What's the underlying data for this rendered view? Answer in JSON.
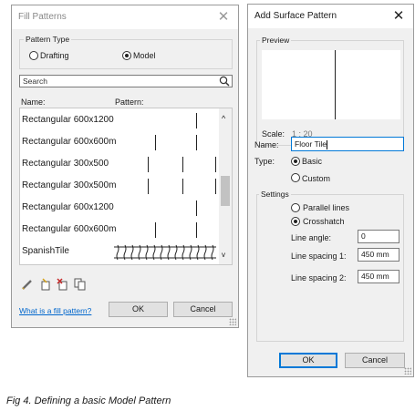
{
  "fill_patterns": {
    "title": "Fill Patterns",
    "pattern_type_label": "Pattern Type",
    "drafting_label": "Drafting",
    "model_label": "Model",
    "search_placeholder": "Search",
    "name_header": "Name:",
    "pattern_header": "Pattern:",
    "rows": [
      {
        "name": "Rectangular  600x1200"
      },
      {
        "name": "Rectangular  600x600m"
      },
      {
        "name": "Rectangular 300x500"
      },
      {
        "name": "Rectangular 300x500m"
      },
      {
        "name": "Rectangular 600x1200"
      },
      {
        "name": "Rectangular 600x600m"
      },
      {
        "name": "SpanishTile"
      }
    ],
    "help_link": "What is a fill pattern?",
    "ok_label": "OK",
    "cancel_label": "Cancel"
  },
  "add_surface_pattern": {
    "title": "Add Surface Pattern",
    "preview_label": "Preview",
    "scale_label": "Scale:",
    "scale_value": "1 : 20",
    "name_label": "Name:",
    "name_value": "Floor Tile",
    "type_label": "Type:",
    "basic_label": "Basic",
    "custom_label": "Custom",
    "settings_label": "Settings",
    "parallel_label": "Parallel lines",
    "crosshatch_label": "Crosshatch",
    "line_angle_label": "Line angle:",
    "line_angle_value": "0",
    "spacing1_label": "Line spacing 1:",
    "spacing1_value": "450 mm",
    "spacing2_label": "Line spacing 2:",
    "spacing2_value": "450 mm",
    "ok_label": "OK",
    "cancel_label": "Cancel"
  },
  "caption": "Fig 4. Defining a basic Model Pattern",
  "icons": [
    "close-icon",
    "search-icon",
    "pencil-icon",
    "new-pattern-icon",
    "delete-pattern-icon",
    "duplicate-pattern-icon",
    "scroll-up-icon",
    "scroll-down-icon"
  ],
  "colors": {
    "accent": "#0078d7",
    "link": "#0066cc",
    "selection": "#0078d7"
  }
}
